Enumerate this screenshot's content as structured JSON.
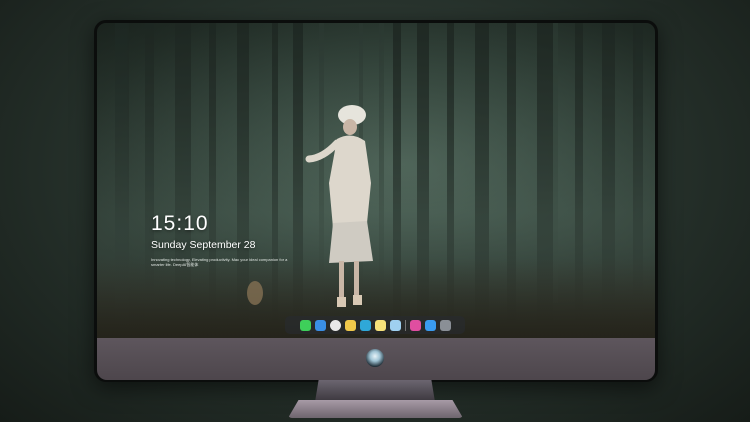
{
  "lock_screen": {
    "time": "15:10",
    "date": "Sunday September 28",
    "tagline": "Innovating technology, Elevating productivity. Mac your ideal companion for a smarter life. DeepAI智能体"
  },
  "dock": {
    "apps": [
      {
        "name": "messages",
        "color": "#3ecf5a"
      },
      {
        "name": "finder",
        "color": "#3a8fe6"
      },
      {
        "name": "safari",
        "color": "#e8e8e8"
      },
      {
        "name": "notes-board",
        "color": "#f0c84a"
      },
      {
        "name": "video-clips",
        "color": "#2fa8d8"
      },
      {
        "name": "notes",
        "color": "#f7e27a"
      },
      {
        "name": "photos-viewer",
        "color": "#9fd0f0"
      },
      {
        "name": "itunes",
        "color": "#e04ea0"
      },
      {
        "name": "app-store",
        "color": "#3a9cf0"
      },
      {
        "name": "camera",
        "color": "#8a8f96"
      }
    ]
  }
}
